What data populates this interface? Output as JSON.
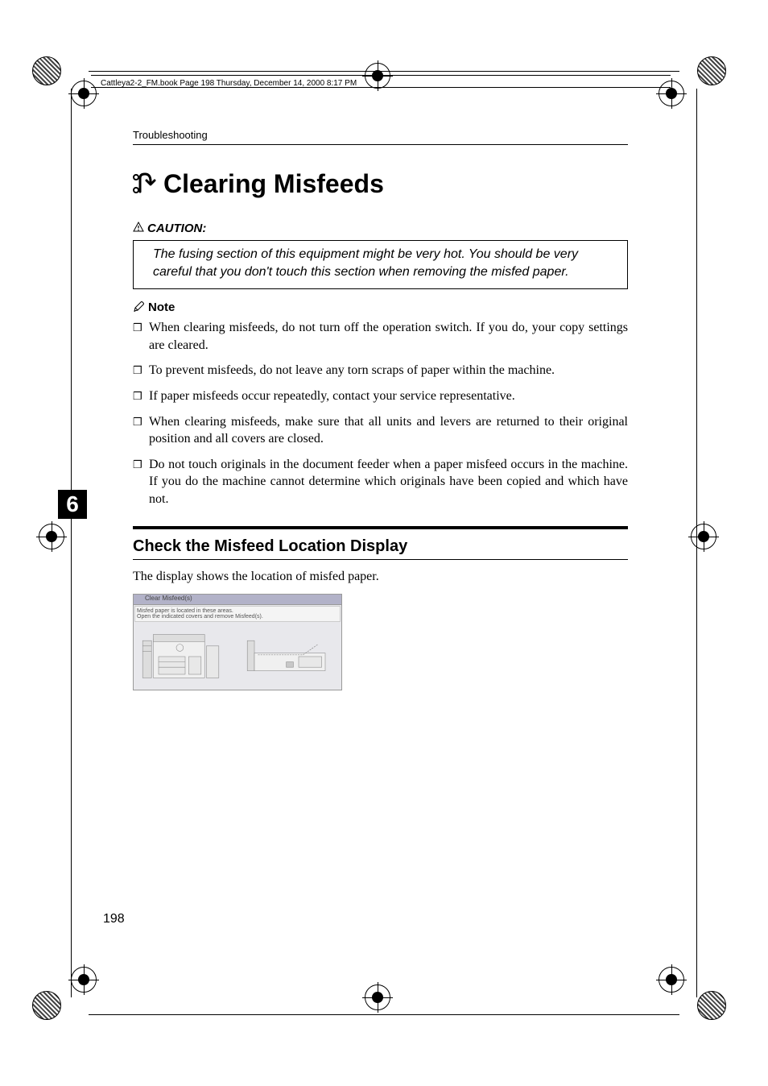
{
  "book_header": "Cattleya2-2_FM.book  Page 198  Thursday, December 14, 2000  8:17 PM",
  "running_head": "Troubleshooting",
  "title": "Clearing Misfeeds",
  "caution_label": "CAUTION:",
  "caution_text": "The fusing section of this equipment might be very hot. You should be very careful that you don't touch this section when removing the misfed paper.",
  "note_label": "Note",
  "notes": [
    "When clearing misfeeds, do not turn off the operation switch. If you do, your copy settings are cleared.",
    "To prevent misfeeds, do not leave any torn scraps of paper within the machine.",
    "If paper misfeeds occur repeatedly, contact your service representative.",
    "When clearing misfeeds, make sure that all units and levers are returned to their original position and all covers are closed.",
    "Do not touch originals in the document feeder when a paper misfeed occurs in the machine. If you do the machine cannot determine which originals have been copied and which have not."
  ],
  "section_title": "Check the Misfeed Location Display",
  "section_body": "The display shows the location of misfed paper.",
  "display_banner": "Clear Misfeed(s)",
  "display_msg1": "Misfed paper is located in these areas.",
  "display_msg2": "Open the indicated covers and remove Misfeed(s).",
  "chapter_num": "6",
  "page_number": "198"
}
